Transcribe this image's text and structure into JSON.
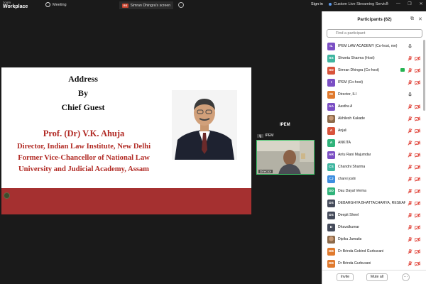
{
  "topbar": {
    "brand_top": "zoom",
    "brand_main": "Workplace",
    "meeting_label": "Meeting",
    "share_badge": "GS",
    "share_label": "Simran Dhingra's screen",
    "more": "…",
    "signin": "Sign in",
    "streaming": "Custom Live Streaming Service",
    "win_controls": [
      "⌃",
      "—",
      "❐",
      "✕"
    ]
  },
  "slide": {
    "title_lines": [
      "Address",
      "By",
      "Chief Guest"
    ],
    "name": "Prof. (Dr) V.K. Ahuja",
    "lines": [
      "Director, Indian Law Institute, New Delhi",
      "Former Vice-Chancellor of National Law",
      "University and Judicial Academy, Assam"
    ]
  },
  "video": {
    "tile_title": "IPEM",
    "tag": "IPEM",
    "name_label": "Director"
  },
  "participants": {
    "title": "Participants (62)",
    "search_placeholder": "Find a participant",
    "items": [
      {
        "initials": "IL",
        "name": "IPEM LAW ACADEMY (Co-host, me)",
        "color": "#7b4fc4",
        "mic": "plain"
      },
      {
        "initials": "SS",
        "name": "Shweta Sharma (Host)",
        "color": "#3eb5a0",
        "mic": "muted"
      },
      {
        "initials": "SD",
        "name": "Simran Dhingra (Co-host)",
        "color": "#d9533b",
        "mic": "muted",
        "sharing": true
      },
      {
        "initials": "I",
        "name": "IPEM (Co-host)",
        "color": "#7b4fc4",
        "mic": "muted"
      },
      {
        "initials": "DI",
        "name": "Director, ILI",
        "color": "#e07a2e",
        "mic": "plain"
      },
      {
        "initials": "AA",
        "name": "Aastha A",
        "color": "#7b4fc4",
        "mic": "muted"
      },
      {
        "initials": "AK",
        "name": "Akhilesh Kakade",
        "color": "#8c6a4a",
        "mic": "muted",
        "photo": true
      },
      {
        "initials": "A",
        "name": "Anjali",
        "color": "#d9533b",
        "mic": "muted"
      },
      {
        "initials": "A",
        "name": "ANKITA",
        "color": "#2fb37a",
        "mic": "muted"
      },
      {
        "initials": "AR",
        "name": "Antu Rani Majumdar",
        "color": "#7b4fc4",
        "mic": "muted"
      },
      {
        "initials": "CS",
        "name": "Chandni Sharma",
        "color": "#3eb5a0",
        "mic": "muted"
      },
      {
        "initials": "CJ",
        "name": "charvi joshi",
        "color": "#3d8ee0",
        "mic": "muted"
      },
      {
        "initials": "DD",
        "name": "Dau Dayal Verma",
        "color": "#2fb37a",
        "mic": "muted"
      },
      {
        "initials": "DS",
        "name": "DEBARGHYA BHATTACHARYA, RESEARCH...",
        "color": "#444a5a",
        "mic": "muted"
      },
      {
        "initials": "DS",
        "name": "Deepit Sheel",
        "color": "#444a5a",
        "mic": "muted"
      },
      {
        "initials": "D",
        "name": "Dhavalkumar",
        "color": "#444a5a",
        "mic": "muted"
      },
      {
        "initials": "DJ",
        "name": "Dipika Jamatia",
        "color": "#8c6a4a",
        "mic": "muted",
        "photo": true
      },
      {
        "initials": "DB",
        "name": "Dr Brinda Gobind Gurbuxani",
        "color": "#e07a2e",
        "mic": "muted"
      },
      {
        "initials": "DB",
        "name": "Dr Brinda Gurbuxani",
        "color": "#e07a2e",
        "mic": "muted"
      }
    ],
    "invite_label": "Invite",
    "mute_all_label": "Mute all",
    "more_label": "···"
  },
  "colors": {
    "accent_green": "#3ec96b",
    "muted_red": "#e0443a",
    "slide_red": "#b12a24",
    "band_red": "#a53030"
  }
}
